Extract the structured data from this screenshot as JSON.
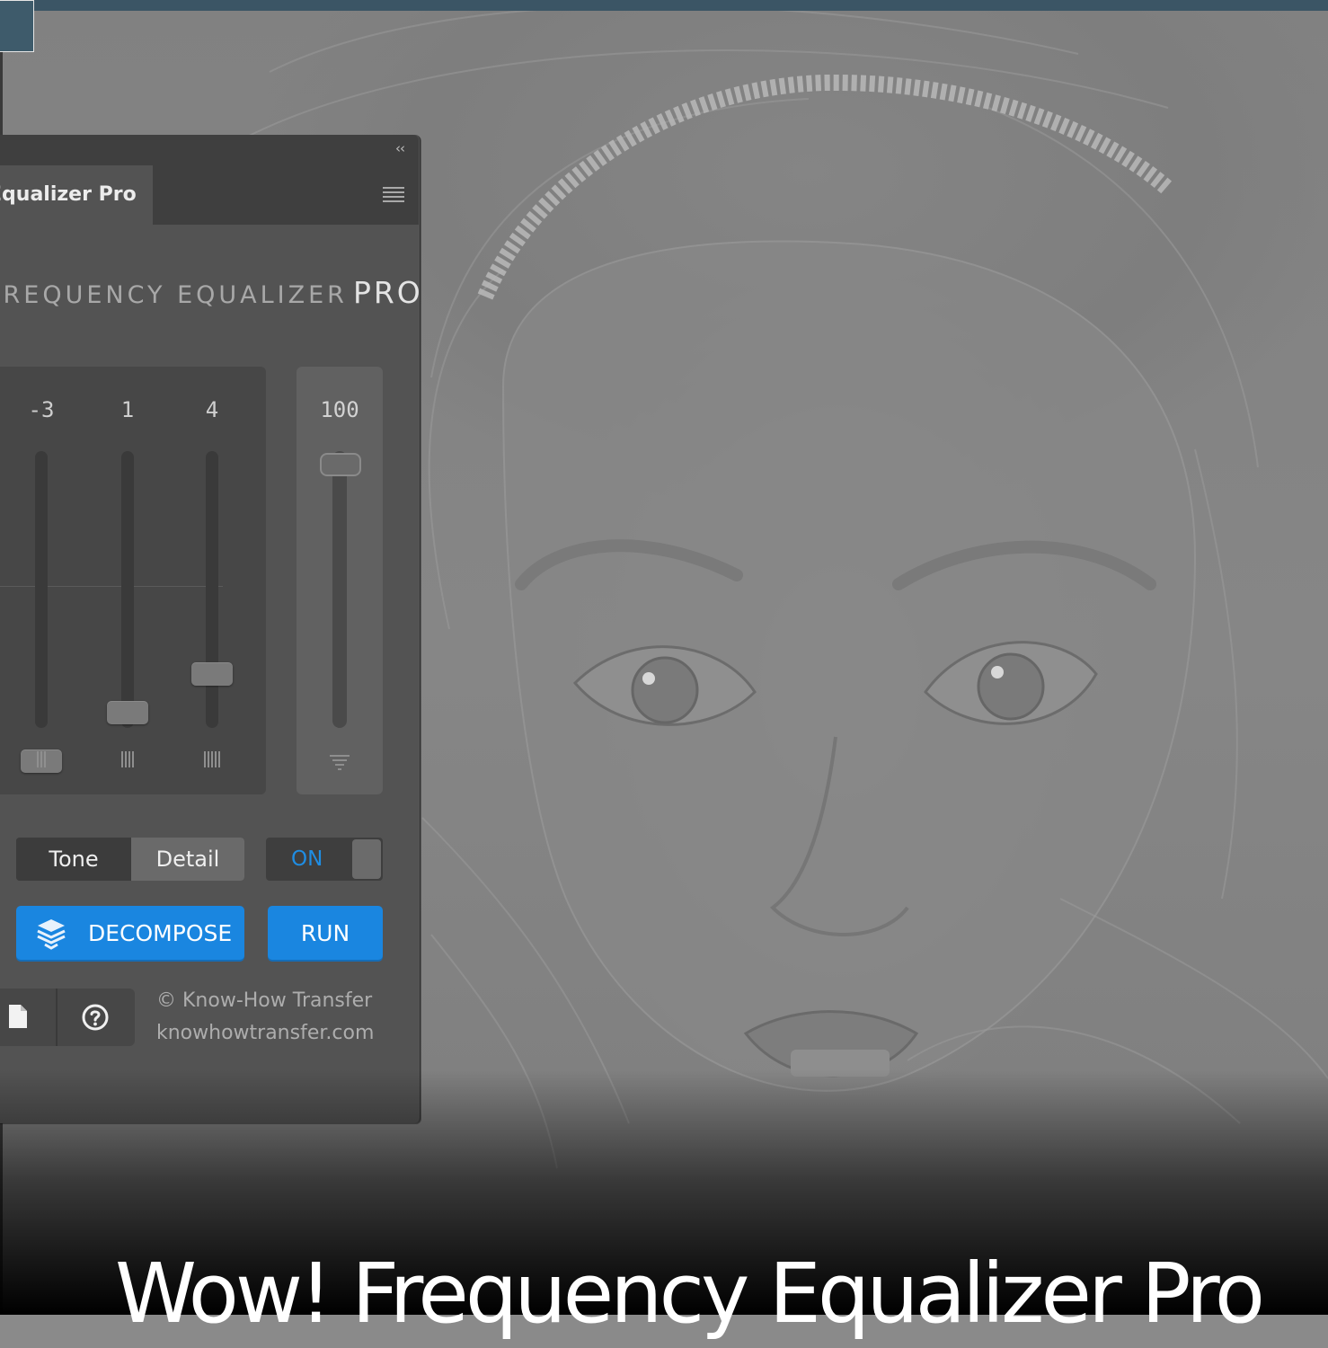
{
  "panel": {
    "tab_title": "Equalizer Pro",
    "collapse_glyph": "‹‹",
    "brand_text": "FREQUENCY EQUALIZER",
    "brand_suffix": "PRO",
    "bands": [
      {
        "value": "-3",
        "level": -3,
        "icon": "bars-3"
      },
      {
        "value": "1",
        "level": 1,
        "icon": "bars-4"
      },
      {
        "value": "4",
        "level": 4,
        "icon": "bars-5"
      }
    ],
    "master": {
      "value": "100",
      "level": 100,
      "icon": "filter-icon"
    },
    "mode_tabs": {
      "tone": "Tone",
      "detail": "Detail",
      "selected": "Detail"
    },
    "toggle_label": "ON",
    "decompose_label": "DECOMPOSE",
    "run_label": "RUN",
    "credit_line1": "© Know-How Transfer",
    "credit_line2": "knowhowtransfer.com"
  },
  "caption": "Wow! Frequency Equalizer Pro",
  "colors": {
    "accent_blue": "#1a86e0",
    "toggle_on_text": "#1f8de3",
    "panel_bg": "#535353",
    "header_strip": "#3b5565"
  }
}
